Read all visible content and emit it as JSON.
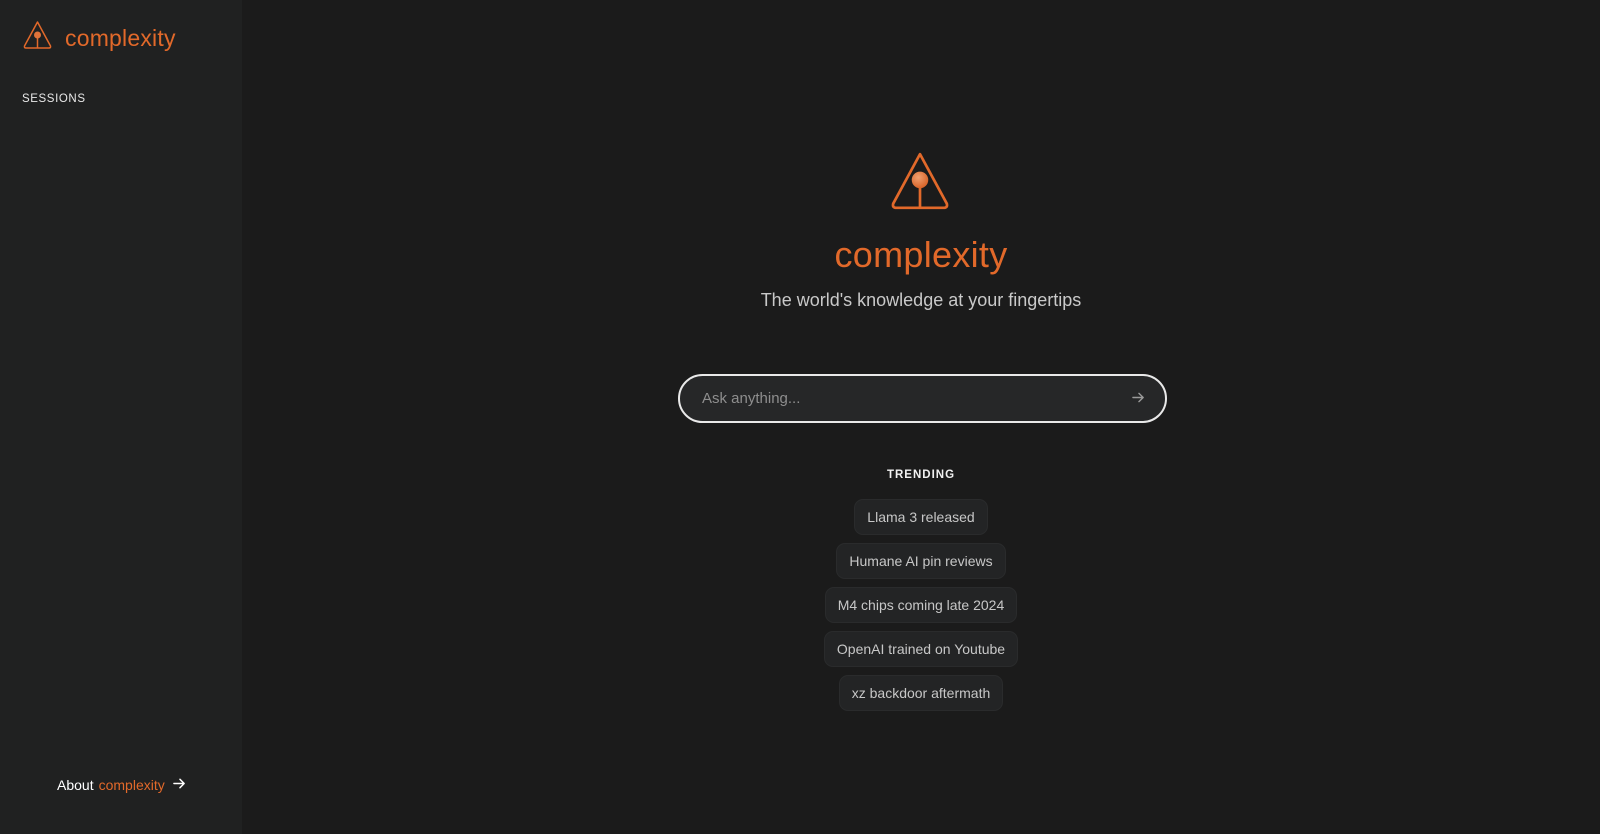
{
  "brand": {
    "name": "complexity",
    "accent_color": "#e2692a"
  },
  "sidebar": {
    "sessions_label": "SESSIONS",
    "about": {
      "label": "About",
      "brand": "complexity",
      "icon": "arrow-right-icon"
    }
  },
  "hero": {
    "title": "complexity",
    "subtitle": "The world's knowledge at your fingertips",
    "logo_icon": "triangle-lamp-logo"
  },
  "search": {
    "placeholder": "Ask anything...",
    "value": "",
    "submit_icon": "arrow-right-icon"
  },
  "trending": {
    "label": "TRENDING",
    "items": [
      "Llama 3 released",
      "Humane AI pin reviews",
      "M4 chips coming late 2024",
      "OpenAI trained on Youtube",
      "xz backdoor aftermath"
    ]
  }
}
